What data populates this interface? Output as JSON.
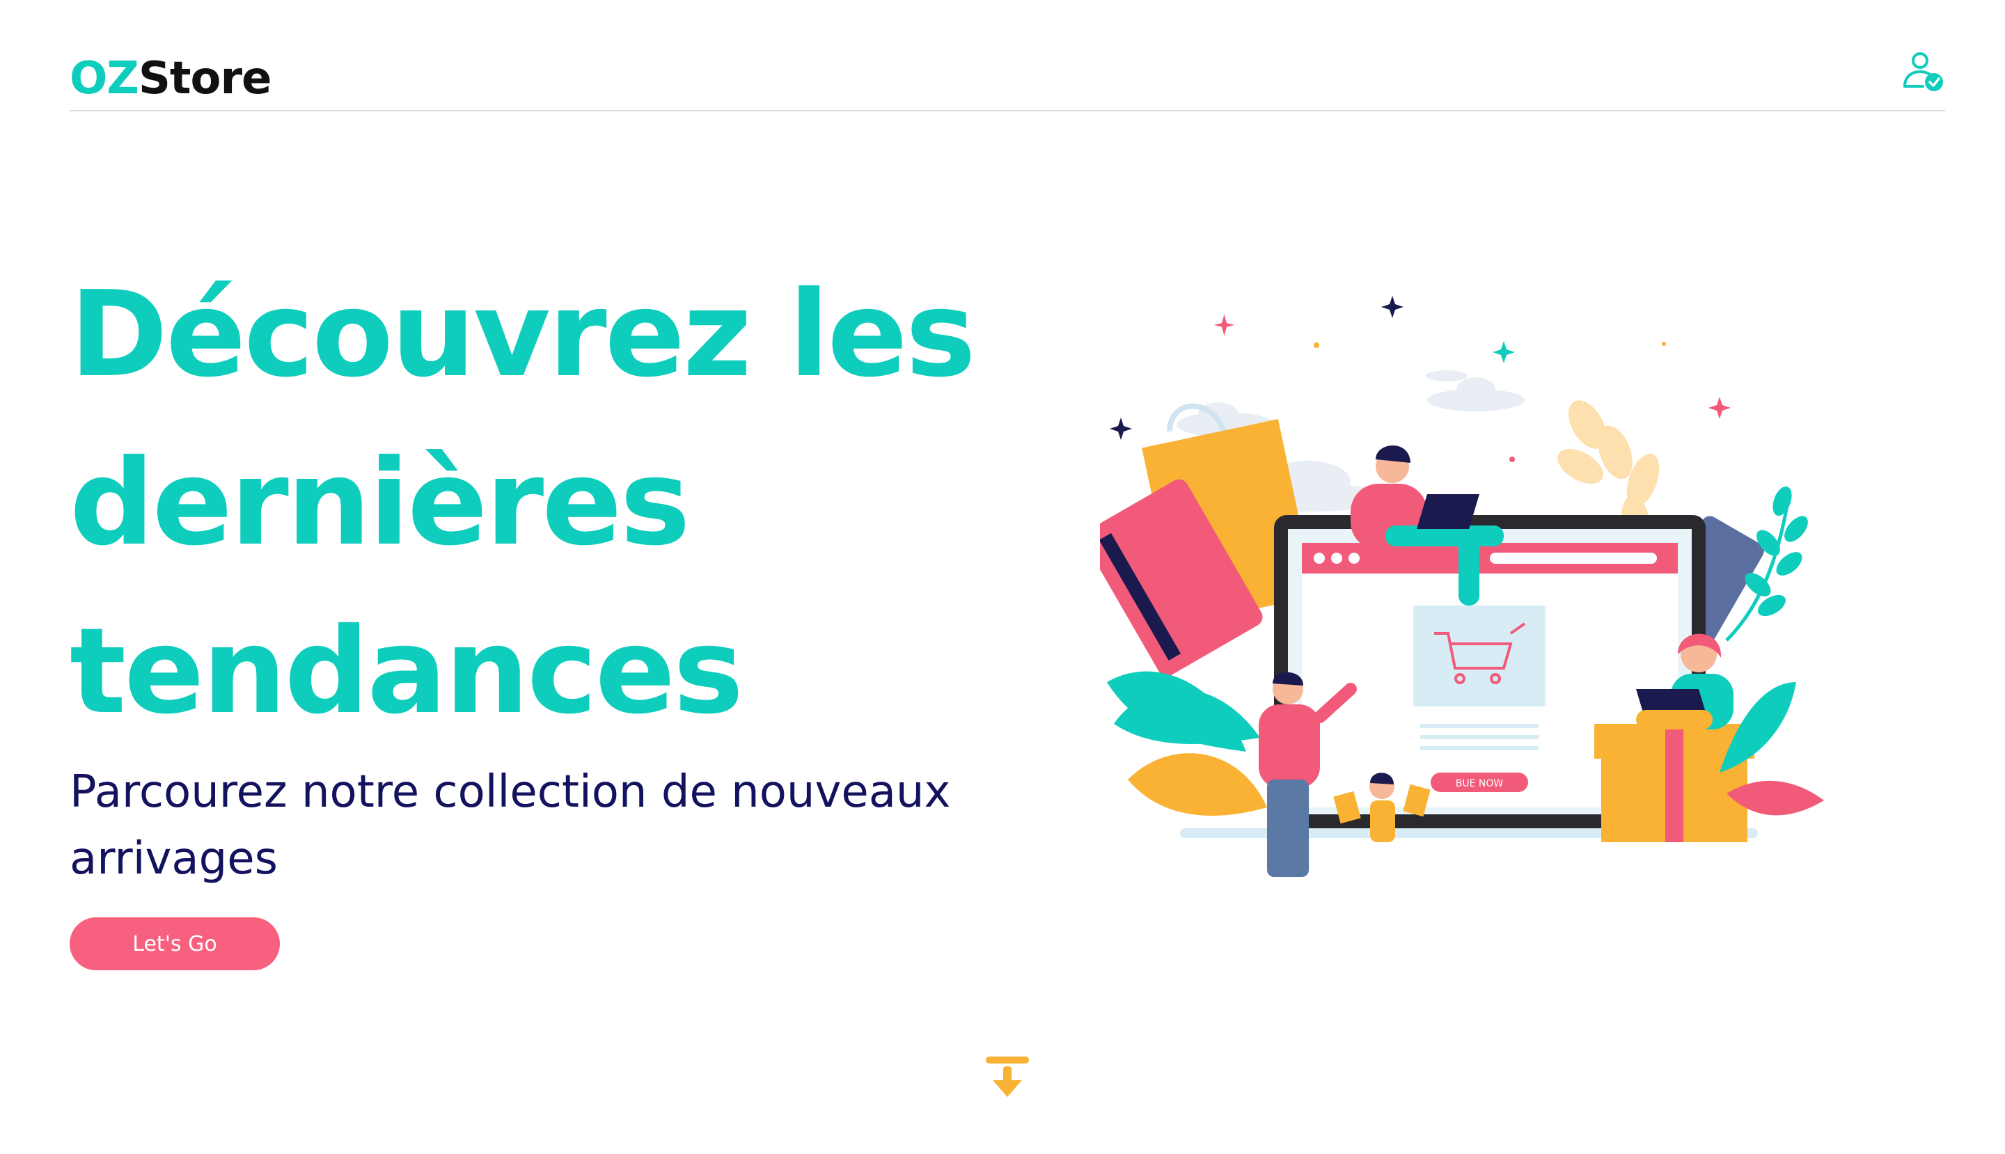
{
  "header": {
    "logo_prefix": "OZ",
    "logo_suffix": "Store",
    "user_icon": "user-check-icon"
  },
  "hero": {
    "title_line1": "Découvrez les",
    "title_line2": "dernières",
    "title_line3": "tendances",
    "subtitle": "Parcourez notre collection de nouveaux arrivages",
    "cta_label": "Let's Go"
  },
  "illustration": {
    "buy_button_label": "BUE NOW"
  },
  "scroll": {
    "icon": "arrow-down-to-line-icon"
  },
  "colors": {
    "brand": "#0ecdbd",
    "accent": "#f7607e",
    "dark": "#13125e",
    "yellow": "#f9b233"
  }
}
